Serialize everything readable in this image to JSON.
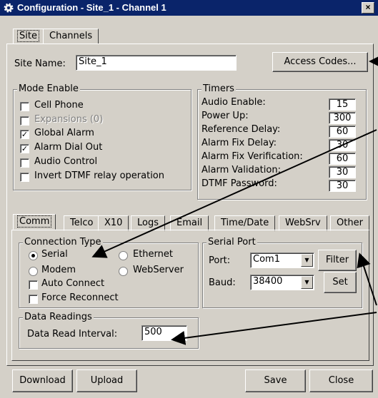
{
  "window": {
    "title": "Configuration - Site_1 - Channel 1",
    "close_glyph": "×"
  },
  "top_tabs": [
    "Site",
    "Channels"
  ],
  "site": {
    "name_label": "Site Name:",
    "name_value": "Site_1",
    "access_codes_label": "Access Codes..."
  },
  "mode_enable": {
    "title": "Mode Enable",
    "items": [
      {
        "label": "Cell Phone",
        "checked": false,
        "disabled": false
      },
      {
        "label": "Expansions (0)",
        "checked": false,
        "disabled": true
      },
      {
        "label": "Global Alarm",
        "checked": true,
        "disabled": false
      },
      {
        "label": "Alarm Dial Out",
        "checked": true,
        "disabled": false
      },
      {
        "label": "Audio Control",
        "checked": false,
        "disabled": false
      },
      {
        "label": "Invert DTMF relay operation",
        "checked": false,
        "disabled": false
      }
    ]
  },
  "timers": {
    "title": "Timers",
    "items": [
      {
        "label": "Audio Enable:",
        "value": "15"
      },
      {
        "label": "Power Up:",
        "value": "300"
      },
      {
        "label": "Reference Delay:",
        "value": "60"
      },
      {
        "label": "Alarm Fix Delay:",
        "value": "30"
      },
      {
        "label": "Alarm Fix Verification:",
        "value": "60"
      },
      {
        "label": "Alarm Validation:",
        "value": "30"
      },
      {
        "label": "DTMF Password:",
        "value": "30"
      }
    ]
  },
  "comm_tabs": [
    "Comm",
    "Telco",
    "X10",
    "Logs",
    "Email",
    "Time/Date",
    "WebSrv",
    "Other"
  ],
  "connection_type": {
    "title": "Connection Type",
    "serial": "Serial",
    "ethernet": "Ethernet",
    "modem": "Modem",
    "webserver": "WebServer",
    "auto_connect": "Auto Connect",
    "force_reconnect": "Force Reconnect",
    "selected": "Serial"
  },
  "data_readings": {
    "title": "Data Readings",
    "interval_label": "Data Read Interval:",
    "interval_value": "500"
  },
  "serial_port": {
    "title": "Serial Port",
    "port_label": "Port:",
    "port_value": "Com1",
    "baud_label": "Baud:",
    "baud_value": "38400",
    "filter_label": "Filter",
    "set_label": "Set"
  },
  "footer": {
    "download": "Download",
    "upload": "Upload",
    "save": "Save",
    "close": "Close"
  },
  "icons": {
    "title": "gear-icon",
    "dropdown": "chevron-down-icon",
    "check": "✓"
  }
}
